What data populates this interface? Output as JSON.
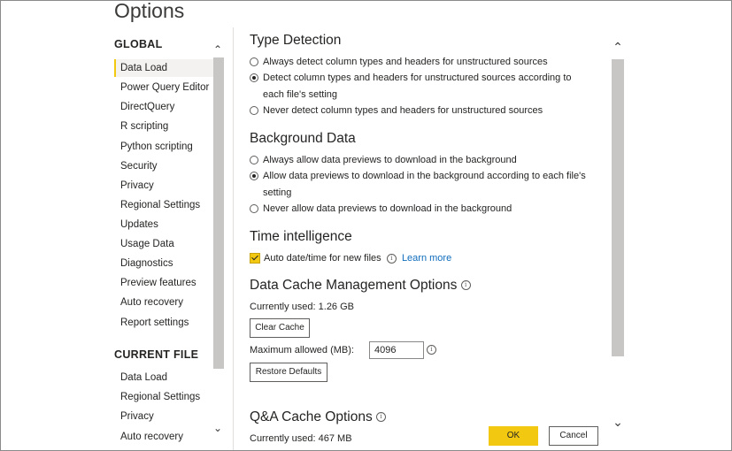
{
  "title": "Options",
  "sidebar": {
    "global_heading": "GLOBAL",
    "global_items": [
      {
        "label": "Data Load",
        "selected": true
      },
      {
        "label": "Power Query Editor"
      },
      {
        "label": "DirectQuery"
      },
      {
        "label": "R scripting"
      },
      {
        "label": "Python scripting"
      },
      {
        "label": "Security"
      },
      {
        "label": "Privacy"
      },
      {
        "label": "Regional Settings"
      },
      {
        "label": "Updates"
      },
      {
        "label": "Usage Data"
      },
      {
        "label": "Diagnostics"
      },
      {
        "label": "Preview features"
      },
      {
        "label": "Auto recovery"
      },
      {
        "label": "Report settings"
      }
    ],
    "current_heading": "CURRENT FILE",
    "current_items": [
      {
        "label": "Data Load"
      },
      {
        "label": "Regional Settings"
      },
      {
        "label": "Privacy"
      },
      {
        "label": "Auto recovery"
      }
    ]
  },
  "type_detection": {
    "heading": "Type Detection",
    "options": [
      {
        "label": "Always detect column types and headers for unstructured sources",
        "selected": false
      },
      {
        "label": "Detect column types and headers for unstructured sources according to each file's setting",
        "selected": true
      },
      {
        "label": "Never detect column types and headers for unstructured sources",
        "selected": false
      }
    ]
  },
  "background_data": {
    "heading": "Background Data",
    "options": [
      {
        "label": "Always allow data previews to download in the background",
        "selected": false
      },
      {
        "label": "Allow data previews to download in the background according to each file's setting",
        "selected": true
      },
      {
        "label": "Never allow data previews to download in the background",
        "selected": false
      }
    ]
  },
  "time_intelligence": {
    "heading": "Time intelligence",
    "checkbox_label": "Auto date/time for new files",
    "checked": true,
    "learn_more": "Learn more"
  },
  "data_cache": {
    "heading": "Data Cache Management Options",
    "currently_used": "Currently used: 1.26 GB",
    "clear_button": "Clear Cache",
    "max_label": "Maximum allowed (MB):",
    "max_value": "4096",
    "restore_button": "Restore Defaults"
  },
  "qa_cache": {
    "heading": "Q&A Cache Options",
    "currently_used": "Currently used: 467 MB"
  },
  "footer": {
    "ok_label": "OK",
    "cancel_label": "Cancel"
  },
  "colors": {
    "accent": "#f2c811",
    "link": "#0f6cbd",
    "scrollbar": "#c8c6c4"
  },
  "icons": {
    "scroll_up": "chevron-up-icon",
    "scroll_down": "chevron-down-icon",
    "info": "info-icon"
  }
}
